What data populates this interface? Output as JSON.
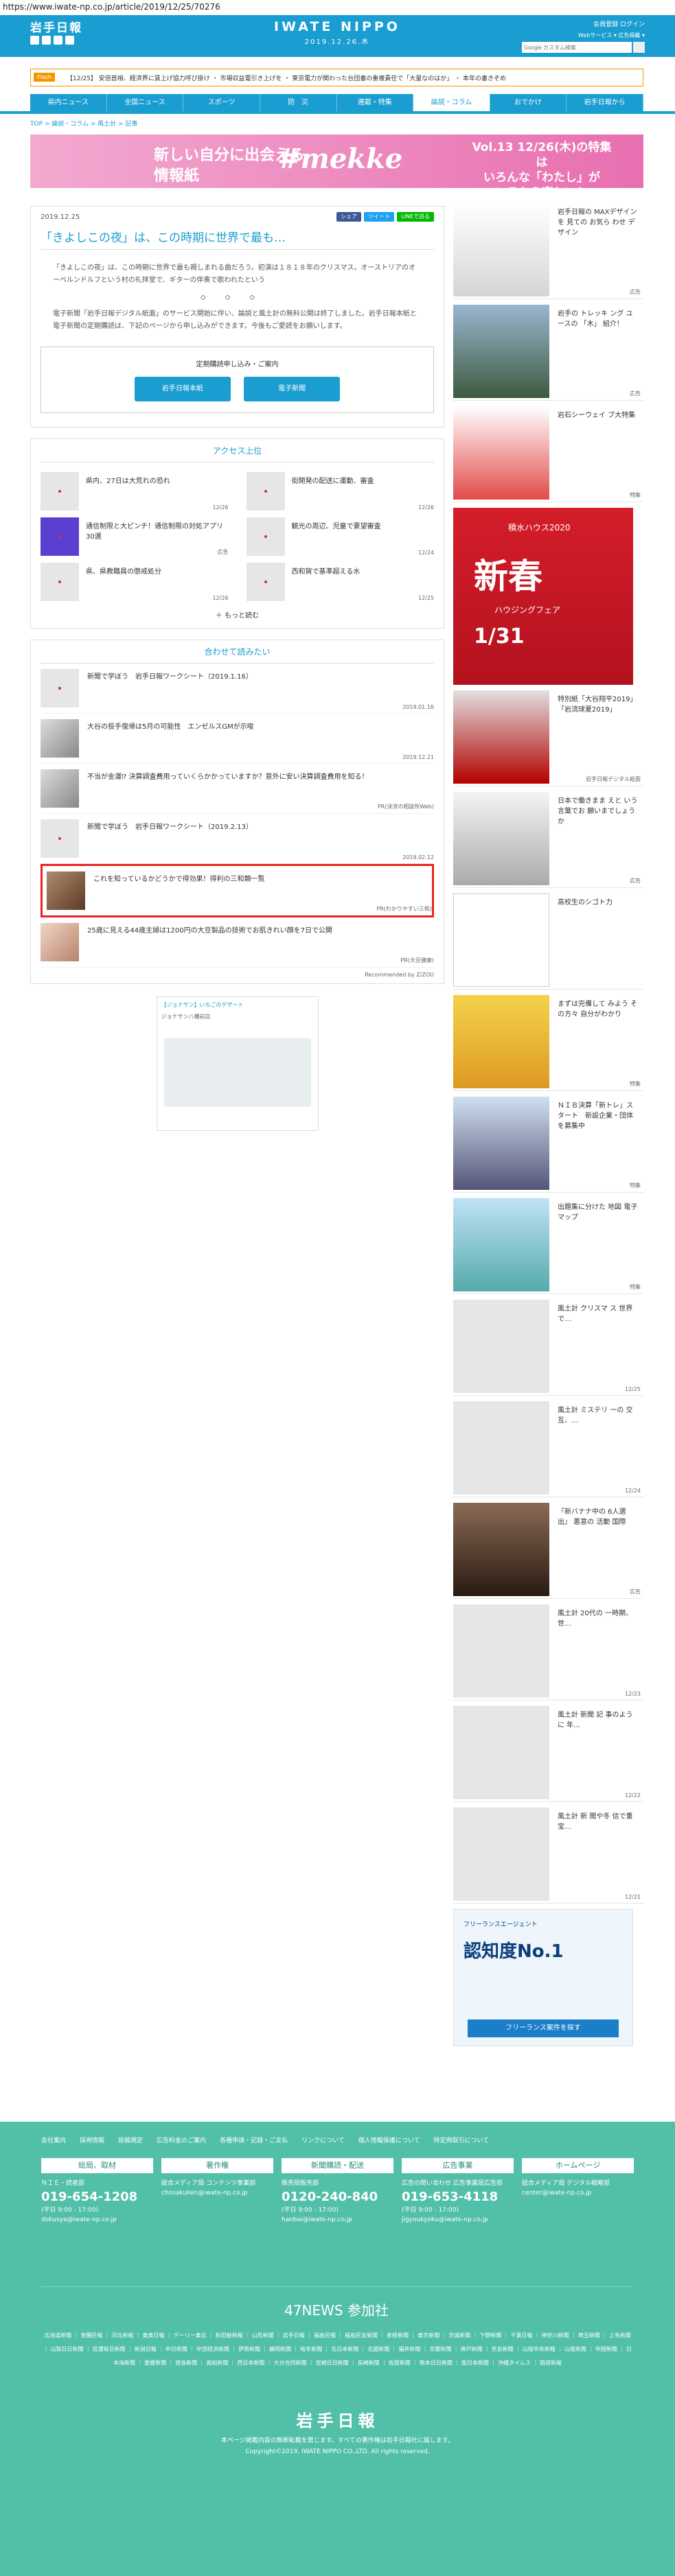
{
  "url": "https://www.iwate-np.co.jp/article/2019/12/25/70276",
  "header": {
    "logo_left": "岩手日報",
    "logo_center": "IWATE NIPPO",
    "date": "2019.12.26.木",
    "login": "会員登録 ログイン",
    "links": "Webサービス ▾  広告掲載 ▾",
    "search_placeholder": "Google カスタム検索"
  },
  "flash": {
    "tag": "Flash",
    "text": "【12/25】 安倍首相、経済界に賃上げ協力呼び掛け ・ 市場収益電引き上げを ・ 東京電力が関わった台団書の重複責任で「大量なのはか」 ・ 本年の書きぞめ"
  },
  "nav": [
    "県内ニュース",
    "全国ニュース",
    "スポーツ",
    "防　災",
    "連載・特集",
    "論説・コラム",
    "おでかけ",
    "岩手日報から"
  ],
  "breadcrumb": "TOP > 論説・コラム > 風土計 > 記事",
  "banner": {
    "left1": "新しい自分に出会える",
    "left2": "情報紙",
    "mekke": "#mekke",
    "right1": "Vol.13 12/26(木)の特集は",
    "right2": "いろんな「わたし」が",
    "right3": "いるから楽しい！"
  },
  "article": {
    "date": "2019.12.25",
    "share": [
      "シェア",
      "ツイート",
      "LINEで送る"
    ],
    "title": "「きよしこの夜」は、この時期に世界で最も…",
    "body": "「きよしこの夜」は、この時期に世界で最も親しまれる曲だろう。初演は１８１８年のクリスマス。オーストリアのオーベルンドルフという村の礼拝堂で、ギターの伴奏で歌われたという",
    "notice": "電子新聞「岩手日報デジタル紙面」のサービス開始に伴い、論説と風土計の無料公開は終了しました。岩手日報本紙と電子新聞の定期購読は、下記のページから申し込みができます。今後もご愛読をお願いします。",
    "subscribe_title": "定期購読申し込み・ご案内",
    "btn_paper": "岩手日報本紙",
    "btn_digital": "電子新聞"
  },
  "ranking": {
    "title": "アクセス上位",
    "items": [
      {
        "text": "県内、27日は大荒れの恐れ",
        "date": "12/26"
      },
      {
        "text": "街開発の配送に運動、審査",
        "date": "12/26"
      },
      {
        "text": "通信制限と大ピンチ！通信制限の対処アプリ30選",
        "date": "広告"
      },
      {
        "text": "観光の周辺、児童で要望審査",
        "date": "12/24"
      },
      {
        "text": "県、県教職員の懲戒処分",
        "date": "12/26"
      },
      {
        "text": "西和賀で基準超える水",
        "date": "12/25"
      }
    ],
    "more": "もっと読む"
  },
  "recommend": {
    "title": "合わせて読みたい",
    "items": [
      {
        "text": "新聞で学ぼう　岩手日報ワークシート（2019.1.16）",
        "date": "2019.01.16"
      },
      {
        "text": "大谷の投手復帰は5月の可能性　エンゼルスGMが示唆",
        "date": "2019.12.21"
      },
      {
        "text": "不当が金運⁉ 決算調査費用っていくらかかっていますか？意外に安い決算調査費用を知る！",
        "date": "PR(決済の相談所Web)"
      },
      {
        "text": "新聞で学ぼう　岩手日報ワークシート（2019.2.13）",
        "date": "2019.02.12"
      },
      {
        "text": "これを知っているかどうかで得効果！得利の三和類一覧",
        "date": "PR(わかりやすい三和)"
      },
      {
        "text": "25歳に見える44歳主婦は1200円の大豆製品の技術でお肌きれい顔を7日で公開",
        "date": "PR(大豆健康)"
      }
    ],
    "powered": "Recommended by Z/ZOU"
  },
  "ad_small": {
    "title": "【ジョナサン】いちごのデザート",
    "sub": "ジョナサン八幡前店"
  },
  "sidebar": [
    {
      "text": "岩手日報の MAXデザインを 見ての お気ら わせ デザイン",
      "date": "広告"
    },
    {
      "text": "岩手の トレッキ ング ユースの 「木」 紹介！",
      "date": "広告"
    },
    {
      "text": "岩石シーウェイ ブ大特集",
      "date": "特集"
    },
    {
      "text": "",
      "date": ""
    },
    {
      "text": "特別紙「大谷翔平2019」「岩流球夏2019」",
      "date": "岩手日報デジタル紙面"
    },
    {
      "text": "日本で働きまま えと いう言葉でお 願いまでしょう か",
      "date": "広告"
    },
    {
      "text": "高校生のシゴト力",
      "date": ""
    },
    {
      "text": "まずは完備して みよう その方々 自分がわかり",
      "date": "特集"
    },
    {
      "text": "ＮＩＢ決算「新トレ」スタート　新設企業・団体を募集中",
      "date": "特集"
    },
    {
      "text": "出題集に分けた 地図 電子マップ",
      "date": "特集"
    },
    {
      "text": "風土計 クリスマ ス 世界で…",
      "date": "12/25"
    },
    {
      "text": "風土計 ミステリ ーの 交互、…",
      "date": "12/24"
    },
    {
      "text": "『新バナナ中の 6人選出』 悪意の 活動 国際",
      "date": "広告"
    },
    {
      "text": "風土計 20代の 一時期、世…",
      "date": "12/23"
    },
    {
      "text": "風土計 新聞 記 事のように 年…",
      "date": "12/22"
    },
    {
      "text": "風土計 新 聞や冬 信で重宝…",
      "date": "12/21"
    }
  ],
  "sidebar_ad": {
    "small": "積水ハウス2020",
    "kanji": "新春",
    "sub": "ハウジングフェア",
    "date": "1/31"
  },
  "sidebar_ad2": {
    "top": "フリーランスエージェント",
    "main": "認知度No.1",
    "btn": "フリーランス案件を探す"
  },
  "footer": {
    "links": [
      "会社案内",
      "採用情報",
      "投稿規定",
      "広告料金のご案内",
      "各種申請・記録・ご支払",
      "リンクについて",
      "個人情報保護について",
      "特定商取引について"
    ],
    "contacts": [
      {
        "head": "総局、取材",
        "label": "ＮＩＥ・読者部",
        "tel": "019-654-1208",
        "hours": "(平日 9:00 - 17:00)",
        "mail": "dokusya@iwate-np.co.jp"
      },
      {
        "head": "著作権",
        "label": "総合メディア局 コンテンツ事業部",
        "tel": "",
        "hours": "",
        "mail": "chosakuken@iwate-np.co.jp"
      },
      {
        "head": "新聞購読・配送",
        "label": "販売局販売部",
        "tel": "0120-240-840",
        "hours": "(平日 9:00 - 17:00)",
        "mail": "hanbai@iwate-np.co.jp"
      },
      {
        "head": "広告事業",
        "label": "広告の問い合わせ 広告事業局広告部",
        "tel": "019-653-4118",
        "hours": "(平日 9:00 - 17:00)",
        "mail": "jigyoukyoku@iwate-np.co.jp"
      },
      {
        "head": "ホームページ",
        "label": "総合メディア局 デジタル戦略部",
        "tel": "",
        "hours": "",
        "mail": "center@iwate-np.co.jp"
      }
    ],
    "news47": "47NEWS 参加社",
    "members": "北海道新聞 ｜ 室蘭民報 ｜ 河北新報 ｜ 東奥日報 ｜ デーリー東北 ｜ 秋田魁新報 ｜ 山形新聞 ｜ 岩手日報 ｜ 福島民報 ｜ 福島民友新聞 ｜ 産経新聞 ｜ 東京新聞 ｜ 茨城新聞 ｜ 下野新聞 ｜ 千葉日報 ｜ 神奈川新聞 ｜ 埼玉新聞 ｜ 上毛新聞 ｜ 山梨日日新聞 ｜ 信濃毎日新聞 ｜ 新潟日報 ｜ 中日新聞 ｜ 中部経済新聞 ｜ 伊勢新聞 ｜ 静岡新聞 ｜ 岐阜新聞 ｜ 北日本新聞 ｜ 北國新聞 ｜ 福井新聞 ｜ 京都新聞 ｜ 神戸新聞 ｜ 奈良新聞 ｜ 山陰中央新報 ｜ 山陽新聞 ｜ 中国新聞 ｜ 日本海新聞 ｜ 愛媛新聞 ｜ 徳島新聞 ｜ 高知新聞 ｜ 西日本新聞 ｜ 大分合同新聞 ｜ 宮崎日日新聞 ｜ 長崎新聞 ｜ 佐賀新聞 ｜ 熊本日日新聞 ｜ 南日本新聞 ｜ 沖縄タイムス ｜ 琉球新報",
    "logo": "岩手日報",
    "copy1": "本ページ掲載内容の無断転載を禁じます。すべての著作権は岩手日報社に属します。",
    "copy2": "Copyright©2019, IWATE NIPPO CO.,LTD. All rights reserved."
  }
}
